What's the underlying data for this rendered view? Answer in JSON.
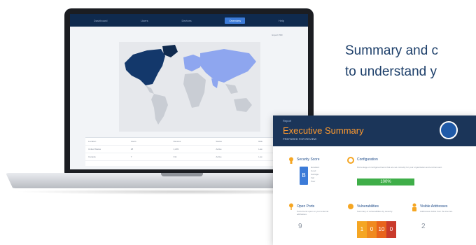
{
  "tagline": {
    "line1": "Summary and c",
    "line2": "to understand y"
  },
  "dashboard": {
    "nav": [
      "Dashboard",
      "Users",
      "Devices",
      "Overview",
      "Help"
    ],
    "active_nav_index": 3,
    "export_label": "Export PDF",
    "table": {
      "headers": [
        "Location",
        "Users",
        "Devices",
        "Status",
        "Risk"
      ],
      "rows": [
        [
          "United States",
          "28",
          "1,203",
          "Active",
          "Low"
        ],
        [
          "Canada",
          "7",
          "311",
          "Active",
          "Low"
        ]
      ]
    },
    "colors": {
      "nav_bg": "#0f2a4e",
      "accent": "#3c7bd8",
      "map_high": "#13386b",
      "map_mid": "#8ea6ef",
      "map_low": "#c9cdd4"
    }
  },
  "report": {
    "top_tab": "Report",
    "title": "Executive Summary",
    "subtitle": "PREPARED FOR REVIEW",
    "security_score": {
      "title": "Security Score",
      "grade": "B",
      "legend": [
        "Excellent",
        "Good",
        "Average",
        "Fair",
        "Poor"
      ]
    },
    "configuration": {
      "title": "Configuration",
      "description": "Percentage of configured items that are set correctly for your organization and environment.",
      "value": "100%",
      "value_fraction": 1.0
    },
    "open_ports": {
      "title": "Open Ports",
      "description": "Ports found open on your external addresses.",
      "value": "9"
    },
    "vulnerabilities": {
      "title": "Vulnerabilities",
      "description": "Summary of vulnerabilities by severity.",
      "values": [
        "1",
        "0",
        "10",
        "0"
      ],
      "colors": [
        "#f5a623",
        "#f08a1f",
        "#e8641c",
        "#c93a2b"
      ]
    },
    "visible_addresses": {
      "title": "Visible Addresses",
      "description": "Addresses visible from the internet.",
      "value": "2"
    }
  }
}
